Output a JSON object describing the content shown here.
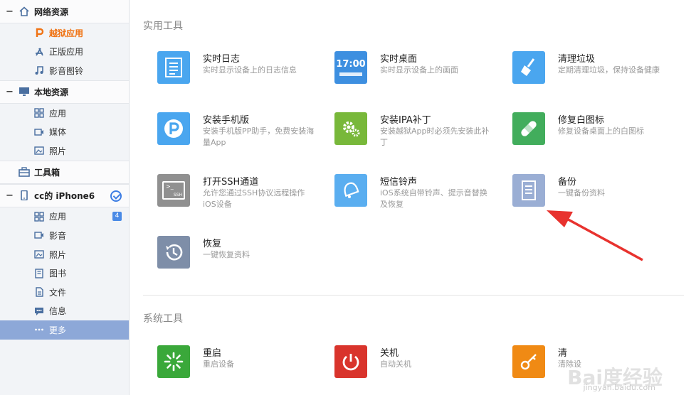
{
  "sidebar": {
    "network": {
      "title": "网络资源",
      "items": [
        {
          "label": "越狱应用"
        },
        {
          "label": "正版应用"
        },
        {
          "label": "影音图铃"
        }
      ]
    },
    "local": {
      "title": "本地资源",
      "items": [
        {
          "label": "应用"
        },
        {
          "label": "媒体"
        },
        {
          "label": "照片"
        }
      ]
    },
    "toolbox": {
      "title": "工具箱"
    },
    "device": {
      "title": "cc的 iPhone6",
      "items": [
        {
          "label": "应用",
          "badge": "4"
        },
        {
          "label": "影音"
        },
        {
          "label": "照片"
        },
        {
          "label": "图书"
        },
        {
          "label": "文件"
        },
        {
          "label": "信息"
        },
        {
          "label": "更多"
        }
      ]
    }
  },
  "main": {
    "practical_title": "实用工具",
    "system_title": "系统工具",
    "tools": [
      {
        "name": "实时日志",
        "desc": "实时显示设备上的日志信息",
        "color": "#4aa6ef"
      },
      {
        "name": "实时桌面",
        "desc": "实时显示设备上的画面",
        "color": "#3d8fe0",
        "icon_text": "17:00"
      },
      {
        "name": "清理垃圾",
        "desc": "定期清理垃圾，保持设备健康",
        "color": "#4aa6ef"
      },
      {
        "name": "安装手机版",
        "desc": "安装手机版PP助手，免费安装海量App",
        "color": "#4aa6ef"
      },
      {
        "name": "安装IPA补丁",
        "desc": "安装越狱App时必须先安装此补丁",
        "color": "#78b83a"
      },
      {
        "name": "修复白图标",
        "desc": "修复设备桌面上的白图标",
        "color": "#42ad5c"
      },
      {
        "name": "打开SSH通道",
        "desc": "允许您通过SSH协议远程操作iOS设备",
        "color": "#909090",
        "icon_text": "SSH"
      },
      {
        "name": "短信铃声",
        "desc": "iOS系统自带铃声、提示音替换及恢复",
        "color": "#5aaef0"
      },
      {
        "name": "备份",
        "desc": "一键备份资料",
        "color": "#9aaed4"
      },
      {
        "name": "恢复",
        "desc": "一键恢复资料",
        "color": "#7e8ea8"
      }
    ],
    "system_tools": [
      {
        "name": "重启",
        "desc": "重启设备",
        "color": "#3aa83a"
      },
      {
        "name": "关机",
        "desc": "自动关机",
        "color": "#d9342c"
      },
      {
        "name": "清",
        "desc": "清除设",
        "color": "#f08a14"
      }
    ]
  },
  "watermark": {
    "text": "Bai度经验",
    "url": "jingyan.baidu.com"
  },
  "colors": {
    "accent": "#3d7de3",
    "selected": "#8da8d8",
    "orange": "#f07314",
    "arrow": "#e8322e"
  }
}
